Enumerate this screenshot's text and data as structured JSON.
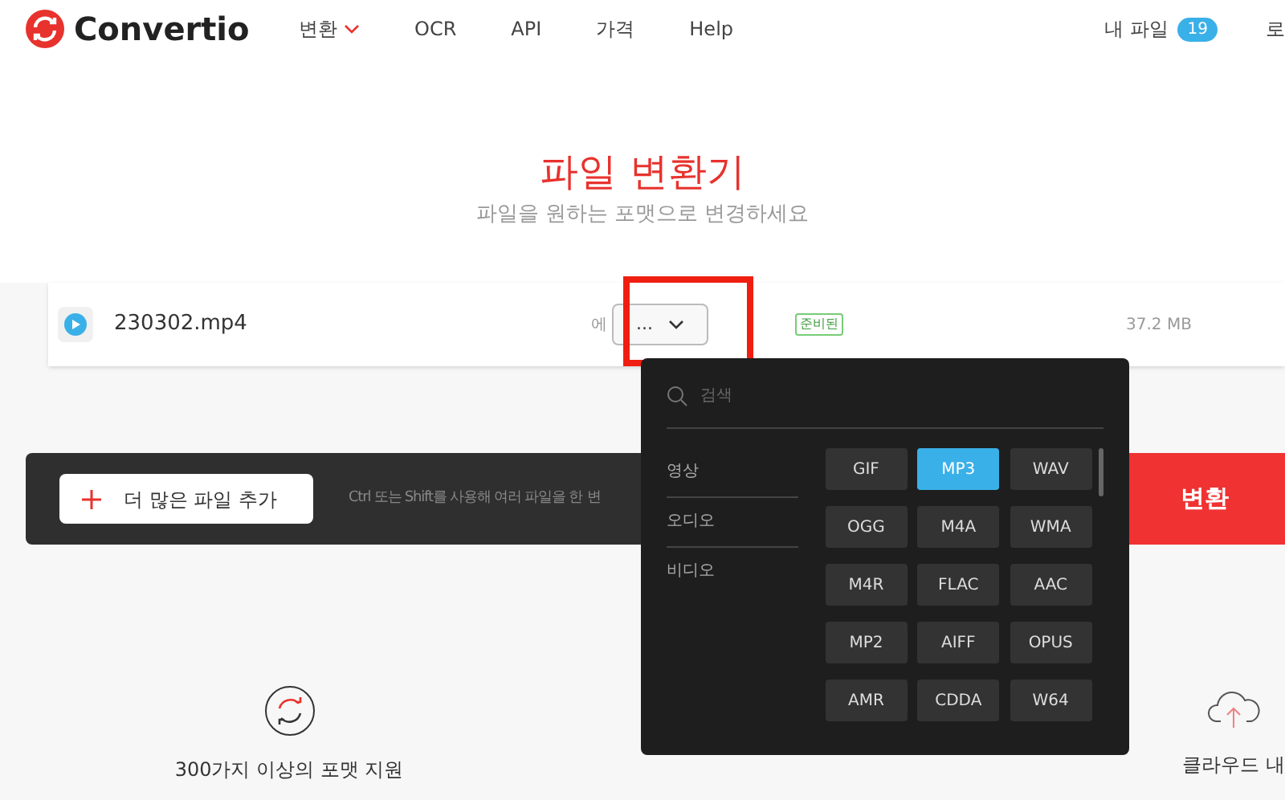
{
  "header": {
    "logo": "Convertio",
    "nav": [
      {
        "label": "변환",
        "has_caret": true
      },
      {
        "label": "OCR",
        "has_caret": false
      },
      {
        "label": "API",
        "has_caret": false
      },
      {
        "label": "가격",
        "has_caret": false
      },
      {
        "label": "Help",
        "has_caret": false
      }
    ],
    "my_files": "내 파일",
    "my_files_count": "19",
    "login_cut": "로"
  },
  "hero": {
    "title": "파일 변환기",
    "subtitle": "파일을 원하는 포맷으로 변경하세요"
  },
  "file": {
    "name": "230302.mp4",
    "to_label_cut": "에",
    "format_value": "...",
    "status": "준비된",
    "size": "37.2 MB"
  },
  "action_bar": {
    "add_button": "더 많은 파일 추가",
    "hint": "Ctrl 또는 Shift를 사용해 여러 파일을 한",
    "hidden_label_cut": "변",
    "convert_button": "변환"
  },
  "format_menu": {
    "search": {
      "placeholder": "검색"
    },
    "categories": [
      "영상",
      "오디오",
      "비디오"
    ],
    "formats": [
      {
        "label": "GIF",
        "selected": false
      },
      {
        "label": "MP3",
        "selected": true
      },
      {
        "label": "WAV",
        "selected": false
      },
      {
        "label": "OGG",
        "selected": false
      },
      {
        "label": "M4A",
        "selected": false
      },
      {
        "label": "WMA",
        "selected": false
      },
      {
        "label": "M4R",
        "selected": false
      },
      {
        "label": "FLAC",
        "selected": false
      },
      {
        "label": "AAC",
        "selected": false
      },
      {
        "label": "MP2",
        "selected": false
      },
      {
        "label": "AIFF",
        "selected": false
      },
      {
        "label": "OPUS",
        "selected": false
      },
      {
        "label": "AMR",
        "selected": false
      },
      {
        "label": "CDDA",
        "selected": false
      },
      {
        "label": "W64",
        "selected": false
      }
    ]
  },
  "features": [
    {
      "label": "300가지 이상의 포맷 지원"
    },
    {
      "label": "클라우드 내"
    }
  ]
}
